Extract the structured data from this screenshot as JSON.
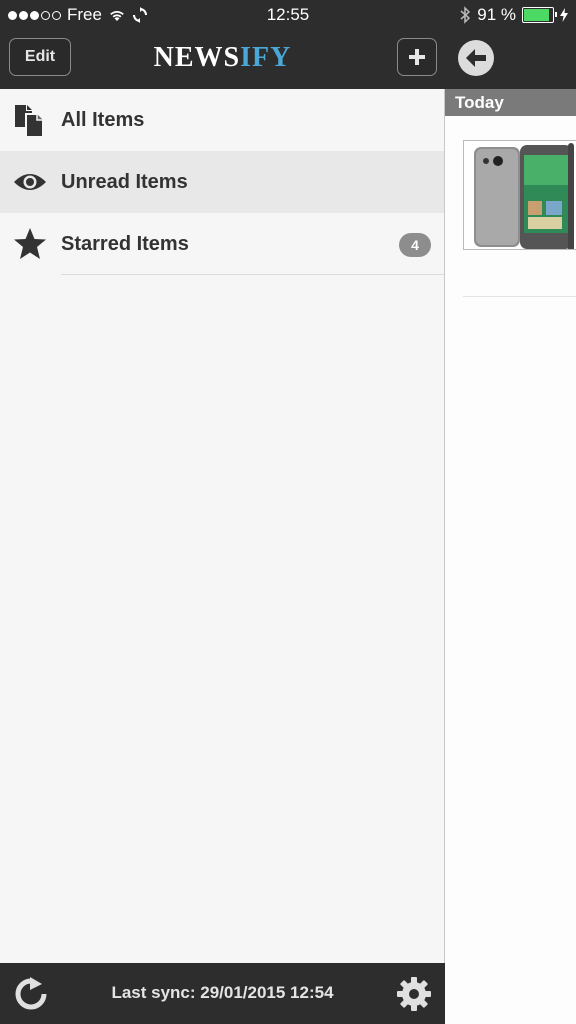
{
  "status_bar": {
    "carrier": "Free",
    "time": "12:55",
    "battery_percent": "91 %",
    "battery_level": 0.91,
    "signal_bars_filled": 3,
    "signal_bars_total": 5,
    "icons": [
      "wifi-icon",
      "sync-icon",
      "bluetooth-icon",
      "charging-icon"
    ]
  },
  "header": {
    "edit_label": "Edit",
    "logo_part1": "NEWS",
    "logo_part2": "IFY",
    "add_label": "+"
  },
  "menu": {
    "items": [
      {
        "label": "All Items",
        "icon": "documents-icon"
      },
      {
        "label": "Unread Items",
        "icon": "eye-icon",
        "selected": true
      },
      {
        "label": "Starred Items",
        "icon": "star-icon",
        "badge": "4"
      }
    ]
  },
  "right_panel": {
    "section_title": "Today",
    "back_icon": "back-arrow-icon"
  },
  "footer": {
    "sync_text": "Last sync: 29/01/2015 12:54"
  },
  "colors": {
    "bar_bg": "#2d2d2d",
    "logo_accent": "#4aa7d6",
    "selected_row": "#e8e8e8",
    "battery_fill": "#4cd964"
  }
}
